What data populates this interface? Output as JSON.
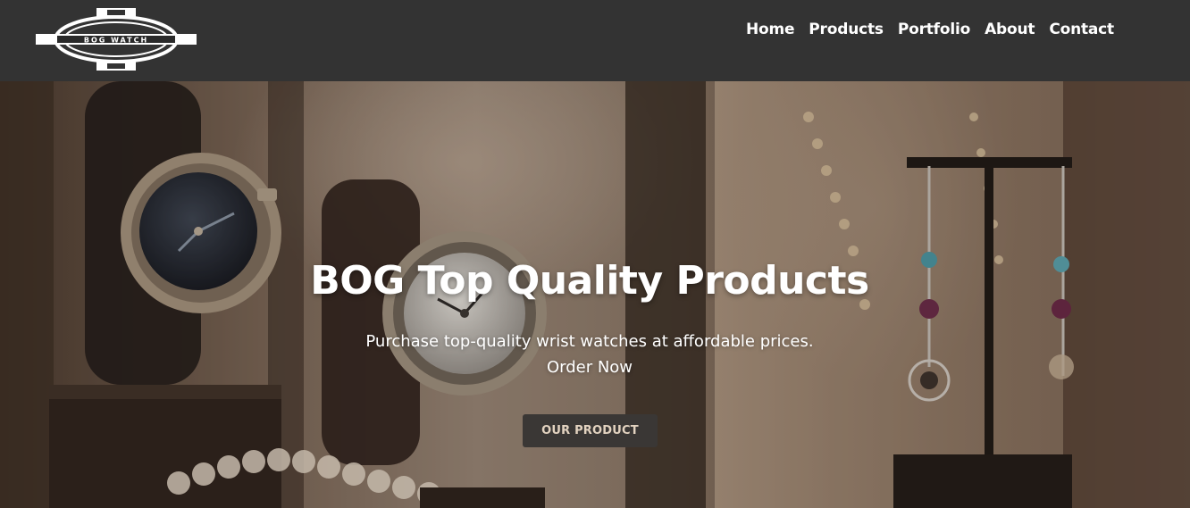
{
  "brand": {
    "logo_text": "BOG WATCH"
  },
  "nav": {
    "items": [
      {
        "label": "Home"
      },
      {
        "label": "Products"
      },
      {
        "label": "Portfolio"
      },
      {
        "label": "About"
      },
      {
        "label": "Contact"
      }
    ]
  },
  "hero": {
    "title": "BOG Top Quality Products",
    "subtitle_line1": "Purchase top-quality wrist watches at affordable prices.",
    "subtitle_line2": "Order Now",
    "button_label": "OUR PRODUCT"
  },
  "colors": {
    "navbar_bg": "#333333",
    "nav_text": "#ffffff",
    "button_bg": "#3a3735",
    "button_text": "#e3d3c0"
  }
}
